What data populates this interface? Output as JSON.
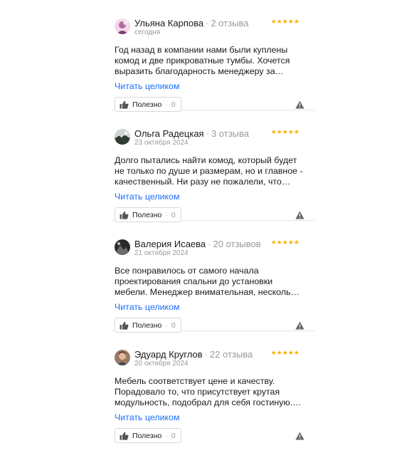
{
  "colors": {
    "star": "#fcb201",
    "link": "#196dff",
    "muted": "#9a9a9a"
  },
  "reviews": [
    {
      "author": "Ульяна Карпова",
      "review_count": "2 отзыва",
      "date": "сегодня",
      "stars": "★★★★★",
      "rating": 5,
      "text": "Год назад в компании нами были куплены комод и две прикроватные тумбы. Хочется выразить благодарность менеджеру за…",
      "read_more": "Читать целиком",
      "helpful_label": "Полезно",
      "helpful_count": "0",
      "avatar_icon": "avatar-pink-photo"
    },
    {
      "author": "Ольга Радецкая",
      "review_count": "3 отзыва",
      "date": "23 октября 2024",
      "stars": "★★★★★",
      "rating": 5,
      "text": "Долго пытались найти комод, который будет не только по душе и размерам, но и главное - качественный. Ни разу не пожалели, что…",
      "read_more": "Читать целиком",
      "helpful_label": "Полезно",
      "helpful_count": "0",
      "avatar_icon": "avatar-landscape-photo"
    },
    {
      "author": "Валерия Исаева",
      "review_count": "20 отзывов",
      "date": "21 октября 2024",
      "stars": "★★★★★",
      "rating": 5,
      "text": "Все понравилось от самого начала проектирования спальни до установки мебели. Менеджер внимательная, несколь…",
      "read_more": "Читать целиком",
      "helpful_label": "Полезно",
      "helpful_count": "0",
      "avatar_icon": "avatar-dark-photo"
    },
    {
      "author": "Эдуард Круглов",
      "review_count": "22 отзыва",
      "date": "20 октября 2024",
      "stars": "★★★★★",
      "rating": 5,
      "text": "Мебель соответствует цене и качеству. Порадовало то, что присутствует крутая модульность, подобрал для себя гостиную.…",
      "read_more": "Читать целиком",
      "helpful_label": "Полезно",
      "helpful_count": "0",
      "avatar_icon": "avatar-man-photo"
    }
  ]
}
